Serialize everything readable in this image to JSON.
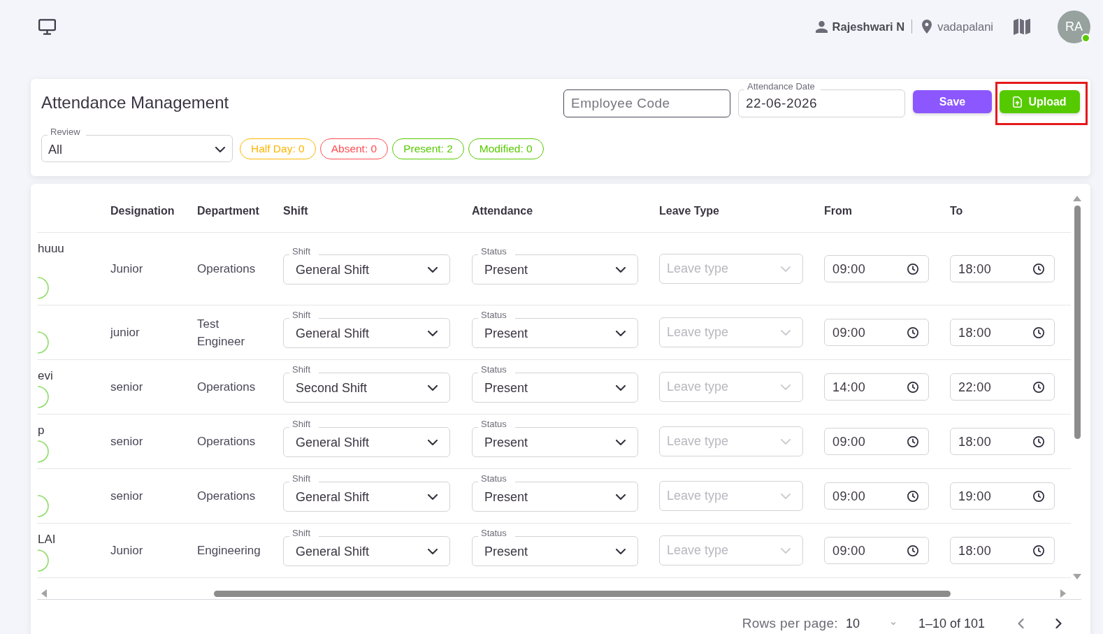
{
  "header": {
    "user_name": "Rajeshwari N",
    "location": "vadapalani",
    "avatar": {
      "initials": "RA",
      "online": true
    }
  },
  "toolbar": {
    "title": "Attendance Management",
    "employee_code": {
      "placeholder": "Employee Code"
    },
    "attendance_date": {
      "label": "Attendance Date",
      "value": "22-06-2026"
    },
    "buttons": [
      {
        "kind": "save",
        "label": "Save"
      },
      {
        "kind": "upload",
        "label": "Upload",
        "highlighted": true
      }
    ],
    "review": {
      "label": "Review",
      "value": "All"
    },
    "chips": [
      {
        "label": "Half Day: 0",
        "color": "#ffb400"
      },
      {
        "label": "Absent: 0",
        "color": "#ff4c51"
      },
      {
        "label": "Present: 2",
        "color": "#56ca00"
      },
      {
        "label": "Modified: 0",
        "color": "#56ca00"
      }
    ]
  },
  "table": {
    "columns": [
      "Designation",
      "Department",
      "Shift",
      "Attendance",
      "Leave Type",
      "From",
      "To"
    ],
    "rows": [
      {
        "column_1": "huuu",
        "designation": "Junior",
        "department": "Operations",
        "shift": {
          "label": "Shift",
          "value": "General Shift"
        },
        "attendance": {
          "label": "Status",
          "value": "Present"
        },
        "leave_type": {
          "placeholder": "Leave type",
          "disabled": true
        },
        "from": "09:00",
        "to": "18:00"
      },
      {
        "designation": "junior",
        "department": "Test Engineer",
        "shift": {
          "label": "Shift",
          "value": "General Shift"
        },
        "attendance": {
          "label": "Status",
          "value": "Present"
        },
        "leave_type": {
          "placeholder": "Leave type",
          "disabled": true
        },
        "from": "09:00",
        "to": "18:00"
      },
      {
        "column_1": "evi",
        "designation": "senior",
        "department": "Operations",
        "shift": {
          "label": "Shift",
          "value": "Second Shift"
        },
        "attendance": {
          "label": "Status",
          "value": "Present"
        },
        "leave_type": {
          "placeholder": "Leave type",
          "disabled": true
        },
        "from": "14:00",
        "to": "22:00"
      },
      {
        "column_1": "p",
        "designation": "senior",
        "department": "Operations",
        "shift": {
          "label": "Shift",
          "value": "General Shift"
        },
        "attendance": {
          "label": "Status",
          "value": "Present"
        },
        "leave_type": {
          "placeholder": "Leave type",
          "disabled": true
        },
        "from": "09:00",
        "to": "18:00"
      },
      {
        "designation": "senior",
        "department": "Operations",
        "shift": {
          "label": "Shift",
          "value": "General Shift"
        },
        "attendance": {
          "label": "Status",
          "value": "Present"
        },
        "leave_type": {
          "placeholder": "Leave type",
          "disabled": true
        },
        "from": "09:00",
        "to": "19:00"
      },
      {
        "column_1": "LAI",
        "designation": "Junior",
        "department": "Engineering",
        "shift": {
          "label": "Shift",
          "value": "General Shift"
        },
        "attendance": {
          "label": "Status",
          "value": "Present"
        },
        "leave_type": {
          "placeholder": "Leave type",
          "disabled": true
        },
        "from": "09:00",
        "to": "18:00"
      }
    ]
  },
  "pagination": {
    "rows_per_page_label": "Rows per page:",
    "rows_per_page": "10",
    "range": "1–10 of 101",
    "previous_disabled": true,
    "next_disabled": false
  }
}
